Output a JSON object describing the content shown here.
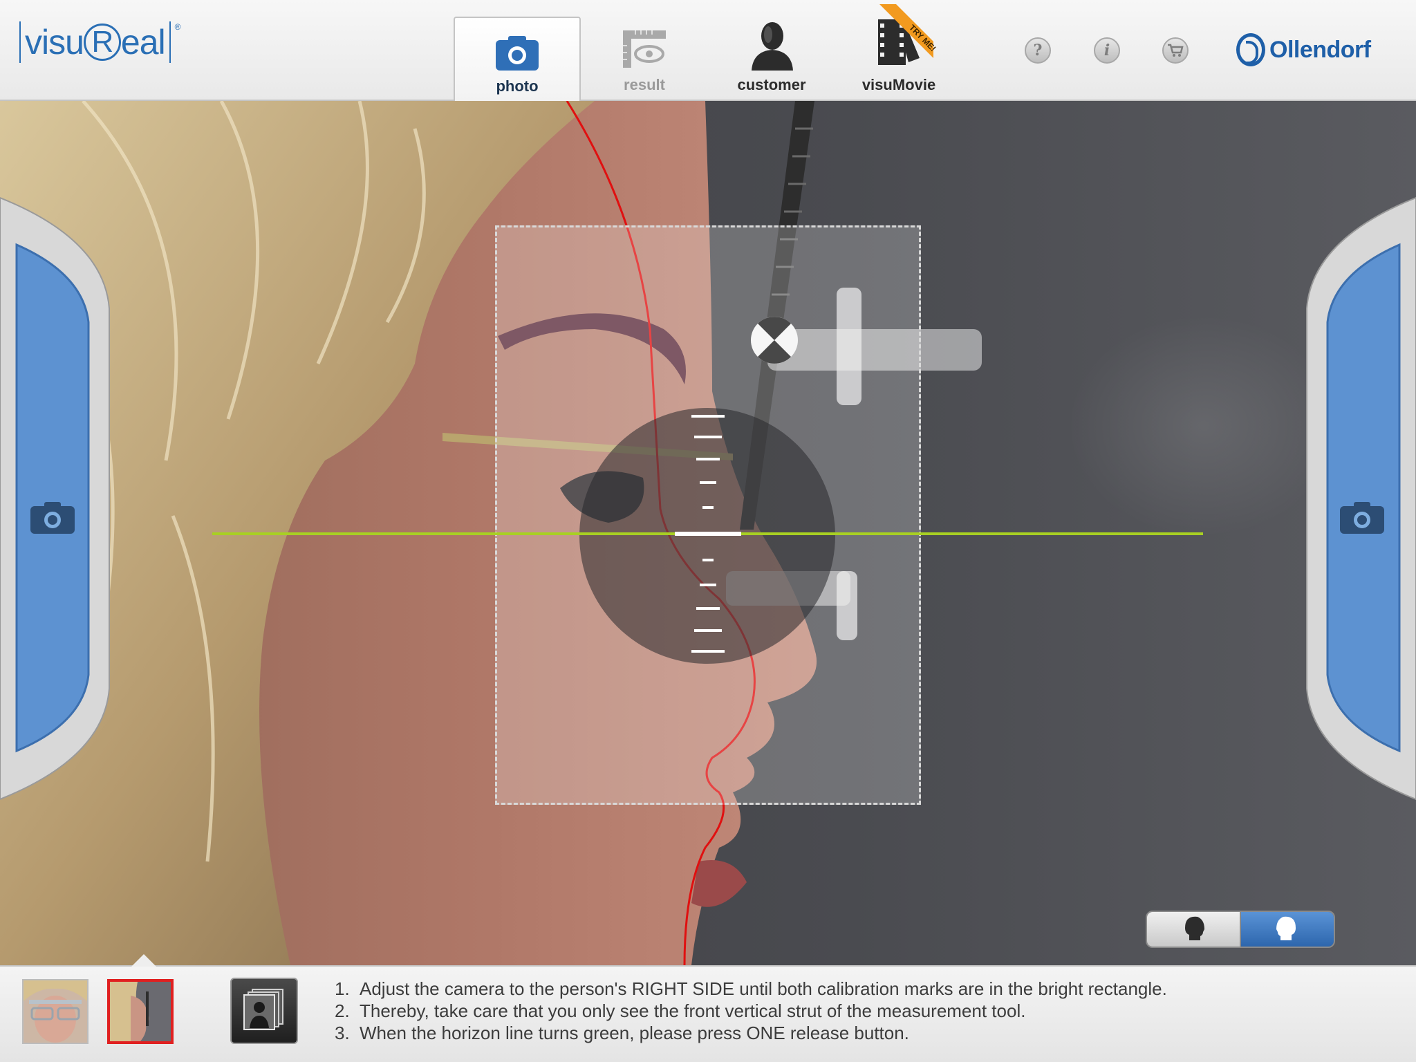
{
  "app": {
    "logo_left": "visu",
    "logo_r": "R",
    "logo_right": "eal",
    "logo_reg": "®",
    "brand": "Ollendorf"
  },
  "tabs": [
    {
      "label": "photo",
      "state": "active",
      "icon": "camera-icon"
    },
    {
      "label": "result",
      "state": "disabled",
      "icon": "ruler-eye-icon"
    },
    {
      "label": "customer",
      "state": "normal",
      "icon": "person-icon"
    },
    {
      "label": "visuMovie",
      "state": "normal",
      "icon": "film-icon",
      "badge": "TRY ME!"
    }
  ],
  "tools": [
    {
      "name": "help",
      "glyph": "?",
      "icon": "help-icon"
    },
    {
      "name": "info",
      "glyph": "i",
      "icon": "info-icon"
    },
    {
      "name": "shop",
      "glyph": "",
      "icon": "cart-icon"
    }
  ],
  "colors": {
    "accent_blue": "#2a6fb5",
    "horizon_ok": "#a8d023",
    "profile_line": "#e01010",
    "selected_thumb": "#e02020"
  },
  "view_toggle": {
    "selected": "right-profile",
    "options": [
      "left-profile",
      "right-profile"
    ]
  },
  "thumbnails": [
    {
      "name": "front-view",
      "selected": false
    },
    {
      "name": "side-view",
      "selected": true
    }
  ],
  "instructions": [
    {
      "num": "1.",
      "text": "Adjust the camera to the person's RIGHT SIDE until both calibration marks are in the bright rectangle."
    },
    {
      "num": "2.",
      "text": "Thereby, take care that you only see the front vertical strut of the measurement tool."
    },
    {
      "num": "3.",
      "text": "When the horizon line turns green, please press ONE release button."
    }
  ]
}
